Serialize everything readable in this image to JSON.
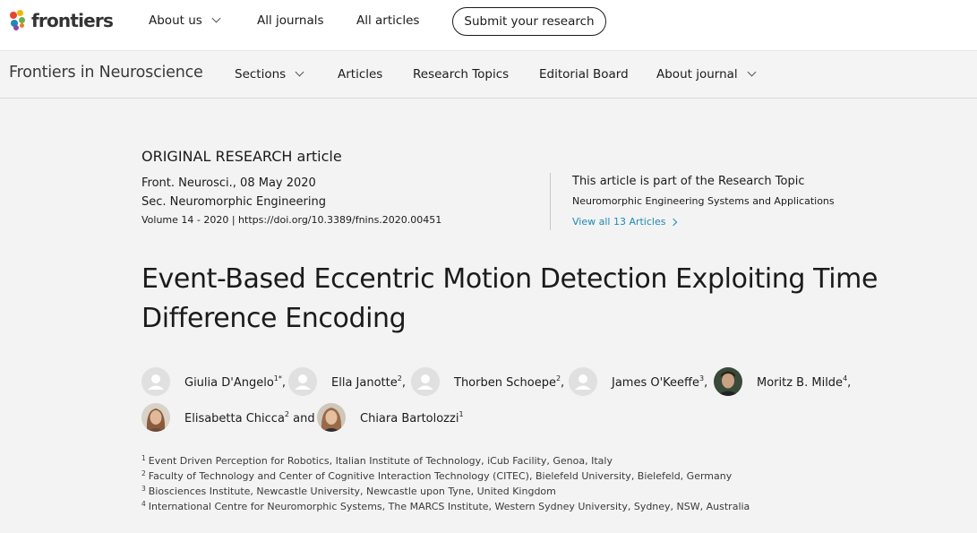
{
  "site": {
    "logo_text": "frontiers",
    "nav": [
      "About us",
      "All journals",
      "All articles"
    ],
    "submit_label": "Submit your research"
  },
  "journal": {
    "title": "Frontiers in Neuroscience",
    "nav": [
      "Sections",
      "Articles",
      "Research Topics",
      "Editorial Board",
      "About journal"
    ]
  },
  "article": {
    "type_label": "ORIGINAL RESEARCH article",
    "published": "Front. Neurosci., 08 May 2020",
    "section": "Sec. Neuromorphic Engineering",
    "volume_doi": "Volume 14 - 2020 | https://doi.org/10.3389/fnins.2020.00451",
    "title": "Event-Based Eccentric Motion Detection Exploiting Time Difference Encoding"
  },
  "research_topic": {
    "heading": "This article is part of the Research Topic",
    "name": "Neuromorphic Engineering Systems and Applications",
    "link_label": "View all 13 Articles"
  },
  "authors": [
    {
      "name": "Giulia D'Angelo",
      "sup": "1*",
      "sep": ","
    },
    {
      "name": "Ella Janotte",
      "sup": "2",
      "sep": ","
    },
    {
      "name": "Thorben Schoepe",
      "sup": "2",
      "sep": ","
    },
    {
      "name": "James O'Keeffe",
      "sup": "3",
      "sep": ","
    },
    {
      "name": "Moritz B. Milde",
      "sup": "4",
      "sep": ","
    },
    {
      "name": "Elisabetta Chicca",
      "sup": "2",
      "sep": " and"
    },
    {
      "name": "Chiara Bartolozzi",
      "sup": "1",
      "sep": ""
    }
  ],
  "affiliations": [
    {
      "num": "1",
      "text": "Event Driven Perception for Robotics, Italian Institute of Technology, iCub Facility, Genoa, Italy"
    },
    {
      "num": "2",
      "text": "Faculty of Technology and Center of Cognitive Interaction Technology (CITEC), Bielefeld University, Bielefeld, Germany"
    },
    {
      "num": "3",
      "text": "Biosciences Institute, Newcastle University, Newcastle upon Tyne, United Kingdom"
    },
    {
      "num": "4",
      "text": "International Centre for Neuromorphic Systems, The MARCS Institute, Western Sydney University, Sydney, NSW, Australia"
    }
  ],
  "colors": {
    "link": "#1e8ab3",
    "text": "#1b1b1b",
    "page_bg": "#f3f3f3"
  }
}
